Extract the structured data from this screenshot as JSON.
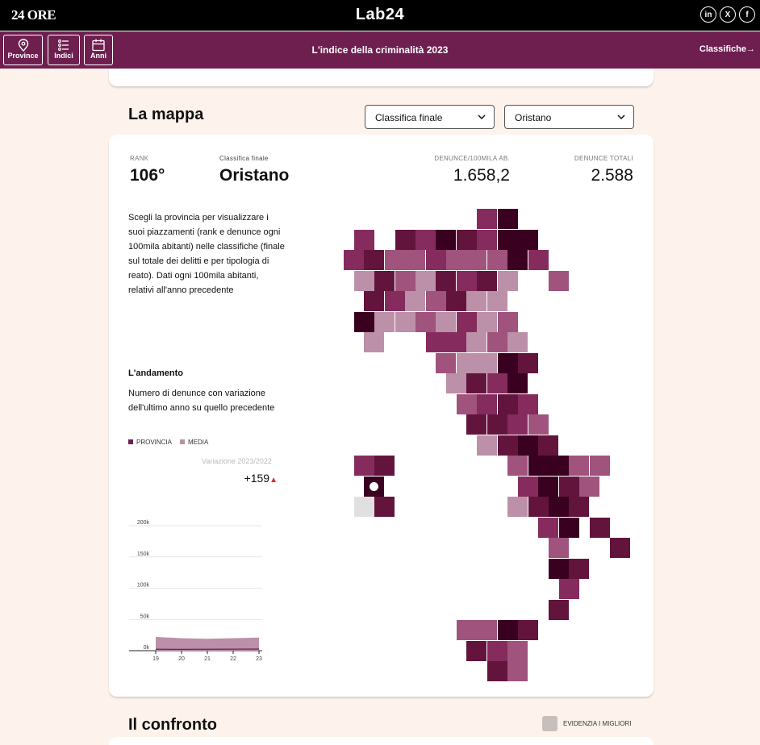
{
  "header": {
    "logo": "24 ORE",
    "brand": "Lab24",
    "social": [
      {
        "name": "linkedin-icon",
        "glyph": "in"
      },
      {
        "name": "x-icon",
        "glyph": "X"
      },
      {
        "name": "facebook-icon",
        "glyph": "f"
      }
    ]
  },
  "nav": {
    "buttons": [
      {
        "label": "Province",
        "icon": "map-pin-icon"
      },
      {
        "label": "Indici",
        "icon": "list-icon"
      },
      {
        "label": "Anni",
        "icon": "calendar-icon"
      }
    ],
    "title": "L'indice della criminalità 2023",
    "link": "Classifiche"
  },
  "map_section": {
    "title": "La mappa",
    "ranking_select": "Classifica finale",
    "province_select": "Oristano"
  },
  "stats": {
    "rank_label": "RANK",
    "rank_value": "106°",
    "ranking_label": "Classifica finale",
    "province": "Oristano",
    "per100k_label": "DENUNCE/100MILA AB.",
    "per100k_value": "1.658,2",
    "total_label": "DENUNCE TOTALI",
    "total_value": "2.588"
  },
  "description": "Scegli la provincia per visualizzare i suoi piazzamenti (rank e denunce ogni 100mila abitanti) nelle classifiche (finale sul totale dei delitti e per tipologia di reato). Dati ogni 100mila abitanti, relativi all'anno precedente",
  "trend": {
    "title": "L'andamento",
    "description": "Numero di denunce con variazione dell'ultimo anno su quello precedente",
    "legend_province": "PROVINCIA",
    "legend_media": "MEDIA",
    "variation_label": "Variazione 2023/2022",
    "variation_value": "+159",
    "variation_arrow": "▲"
  },
  "chart_data": {
    "type": "area",
    "x": [
      "19",
      "20",
      "21",
      "22",
      "23"
    ],
    "series": [
      {
        "name": "PROVINCIA",
        "values": [
          2300,
          2100,
          2300,
          2400,
          2588
        ]
      },
      {
        "name": "MEDIA",
        "values": [
          22000,
          20000,
          19000,
          20000,
          21000
        ]
      }
    ],
    "ylim": [
      0,
      200000
    ],
    "yticks": [
      "0k",
      "50k",
      "100k",
      "150k",
      "200k"
    ],
    "grid": true
  },
  "compare": {
    "title": "Il confronto",
    "highlight_label": "EVIDENZIA I MIGLIORI"
  },
  "colors": {
    "brand": "#6e1f4f",
    "c1": "#3a0020",
    "c2": "#63143d",
    "c3": "#862b5e",
    "c4": "#a0537d",
    "c5": "#bc90a8",
    "province_province": "#6e1f4f",
    "media": "#bc90a8",
    "selected_none": "#e0e0e0",
    "up_arrow": "#e3262a"
  }
}
